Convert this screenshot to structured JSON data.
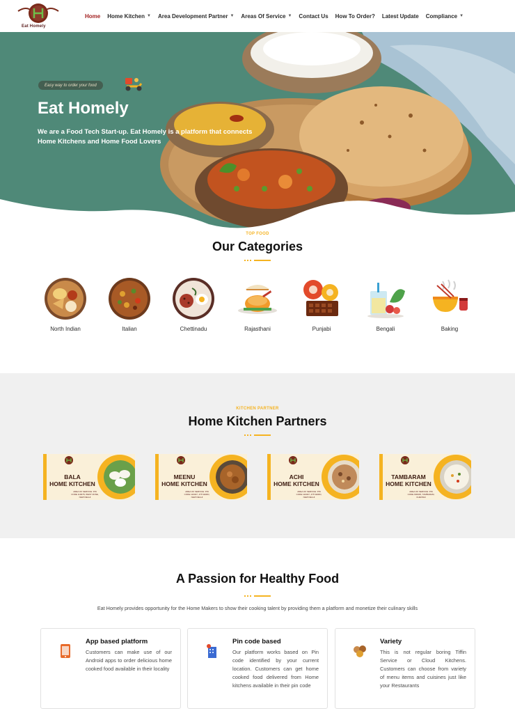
{
  "brand": {
    "logo_text": "Eat Homely"
  },
  "nav": {
    "items": [
      {
        "label": "Home",
        "active": true,
        "has_dropdown": false
      },
      {
        "label": "Home Kitchen",
        "active": false,
        "has_dropdown": true
      },
      {
        "label": "Area Development Partner",
        "active": false,
        "has_dropdown": true
      },
      {
        "label": "Areas Of Service",
        "active": false,
        "has_dropdown": true
      },
      {
        "label": "Contact Us",
        "active": false,
        "has_dropdown": false
      },
      {
        "label": "How To Order?",
        "active": false,
        "has_dropdown": false
      },
      {
        "label": "Latest Update",
        "active": false,
        "has_dropdown": false
      },
      {
        "label": "Compliance",
        "active": false,
        "has_dropdown": true
      }
    ]
  },
  "hero": {
    "tagline": "Easy way to order your food",
    "title": "Eat Homely",
    "description": "We are a Food Tech Start-up. Eat Homely is a platform that connects Home Kitchens and Home Food Lovers"
  },
  "categories": {
    "kicker": "TOP FOOD",
    "title": "Our Categories",
    "items": [
      {
        "label": "North Indian",
        "icon": "north-indian-thali-icon"
      },
      {
        "label": "Italian",
        "icon": "italian-dish-icon"
      },
      {
        "label": "Chettinadu",
        "icon": "chettinadu-plate-icon"
      },
      {
        "label": "Rajasthani",
        "icon": "rajasthani-food-icon"
      },
      {
        "label": "Punjabi",
        "icon": "punjabi-snacks-icon"
      },
      {
        "label": "Bengali",
        "icon": "bengali-drink-icon"
      },
      {
        "label": "Baking",
        "icon": "baking-bowl-icon"
      }
    ]
  },
  "partners": {
    "kicker": "KITCHEN PARTNER",
    "title": "Home Kitchen Partners",
    "items": [
      {
        "name_line1": "BALA",
        "name_line2": "HOME KITCHEN",
        "address": "AREA OF SERVICE: PIN CODE 110078, WEST ZONE, NEW DELHI"
      },
      {
        "name_line1": "MEENU",
        "name_line2": "HOME KITCHEN",
        "address": "AREA OF SERVICE: PIN CODE 110047, 475 WARD, NEW DELHI"
      },
      {
        "name_line1": "ACHI",
        "name_line2": "HOME KITCHEN",
        "address": "AREA OF SERVICE: PIN CODE 110047, 475 WARD, NEW DELHI"
      },
      {
        "name_line1": "TAMBARAM",
        "name_line2": "HOME KITCHEN",
        "address": "AREA OF SERVICE: PIN CODE 600045, TAMBARAM, CHENNAI"
      }
    ]
  },
  "passion": {
    "title": "A Passion for Healthy Food",
    "description": "Eat Homely provides opportunity for the Home Makers to show their cooking talent by providing them a platform and monetize their culinary skills",
    "features": [
      {
        "title": "App based platform",
        "text": "Customers can make use of our Android apps to order delicious home cooked food available in their locality",
        "icon": "mobile-app-icon"
      },
      {
        "title": "Pin code based",
        "text": "Our platform works based on Pin code identified by your current location. Customers can get home cooked food delivered from Home kitchens available in their pin code",
        "icon": "building-location-icon"
      },
      {
        "title": "Variety",
        "text": "This is not regular boring Tiffin Service or Cloud Kitchens. Customers can choose from variety of menu items and cuisines just like your Restaurants",
        "icon": "food-variety-icon"
      }
    ]
  },
  "colors": {
    "accent": "#f5b321",
    "brand": "#a32222",
    "hero_bg": "#4f8978"
  }
}
